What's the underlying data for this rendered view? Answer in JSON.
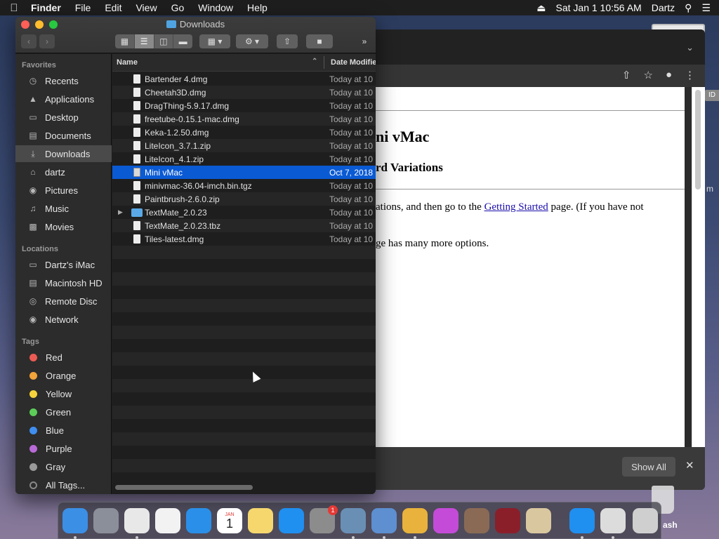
{
  "menubar": {
    "app_name": "Finder",
    "items": [
      "File",
      "Edit",
      "View",
      "Go",
      "Window",
      "Help"
    ],
    "clock": "Sat Jan 1  10:56 AM",
    "user": "Dartz"
  },
  "browser": {
    "heading1": "ni vMac",
    "heading2": "rd Variations",
    "para1_before": "ations, and then go to the ",
    "para1_link": "Getting Started",
    "para1_after": " page. (If you have not",
    "para2": "ge has many more options.",
    "show_all_label": "Show All",
    "edge_tab1": "ID",
    "edge_tab2": "m",
    "trash_label": "ash"
  },
  "finder": {
    "title": "Downloads",
    "sidebar": {
      "favorites_label": "Favorites",
      "favorites": [
        {
          "label": "Recents",
          "icon": "clock-icon"
        },
        {
          "label": "Applications",
          "icon": "applications-icon"
        },
        {
          "label": "Desktop",
          "icon": "desktop-icon"
        },
        {
          "label": "Documents",
          "icon": "documents-icon"
        },
        {
          "label": "Downloads",
          "icon": "downloads-icon",
          "selected": true
        },
        {
          "label": "dartz",
          "icon": "home-icon"
        },
        {
          "label": "Pictures",
          "icon": "camera-icon"
        },
        {
          "label": "Music",
          "icon": "music-note-icon"
        },
        {
          "label": "Movies",
          "icon": "film-icon"
        }
      ],
      "locations_label": "Locations",
      "locations": [
        {
          "label": "Dartz's iMac",
          "icon": "imac-icon"
        },
        {
          "label": "Macintosh HD",
          "icon": "hard-disk-icon"
        },
        {
          "label": "Remote Disc",
          "icon": "disc-icon"
        },
        {
          "label": "Network",
          "icon": "network-globe-icon"
        }
      ],
      "tags_label": "Tags",
      "tags": [
        {
          "label": "Red",
          "color": "#ec5b53"
        },
        {
          "label": "Orange",
          "color": "#f2a33a"
        },
        {
          "label": "Yellow",
          "color": "#f6d33c"
        },
        {
          "label": "Green",
          "color": "#5ccd58"
        },
        {
          "label": "Blue",
          "color": "#3f8ef0"
        },
        {
          "label": "Purple",
          "color": "#b86ad6"
        },
        {
          "label": "Gray",
          "color": "#9a9a9a"
        },
        {
          "label": "All Tags...",
          "color": "#555555"
        }
      ]
    },
    "columns": {
      "name": "Name",
      "date": "Date Modifie"
    },
    "files": [
      {
        "name": "Bartender 4.dmg",
        "date": "Today at 10",
        "kind": "file"
      },
      {
        "name": "Cheetah3D.dmg",
        "date": "Today at 10",
        "kind": "file"
      },
      {
        "name": "DragThing-5.9.17.dmg",
        "date": "Today at 10",
        "kind": "file"
      },
      {
        "name": "freetube-0.15.1-mac.dmg",
        "date": "Today at 10",
        "kind": "file"
      },
      {
        "name": "Keka-1.2.50.dmg",
        "date": "Today at 10",
        "kind": "file"
      },
      {
        "name": "LiteIcon_3.7.1.zip",
        "date": "Today at 10",
        "kind": "file"
      },
      {
        "name": "LiteIcon_4.1.zip",
        "date": "Today at 10",
        "kind": "file"
      },
      {
        "name": "Mini vMac",
        "date": "Oct 7, 2018",
        "kind": "app",
        "selected": true
      },
      {
        "name": "minivmac-36.04-imch.bin.tgz",
        "date": "Today at 10",
        "kind": "file"
      },
      {
        "name": "Paintbrush-2.6.0.zip",
        "date": "Today at 10",
        "kind": "file"
      },
      {
        "name": "TextMate_2.0.23",
        "date": "Today at 10",
        "kind": "folder"
      },
      {
        "name": "TextMate_2.0.23.tbz",
        "date": "Today at 10",
        "kind": "file"
      },
      {
        "name": "Tiles-latest.dmg",
        "date": "Today at 10",
        "kind": "file"
      }
    ]
  },
  "dock": {
    "apps": [
      {
        "name": "finder-icon",
        "color": "#3b8fe5"
      },
      {
        "name": "launchpad-icon",
        "color": "#8a8f99"
      },
      {
        "name": "chrome-icon",
        "color": "#e8e8e8"
      },
      {
        "name": "fantastical-icon",
        "color": "#f2f2f2"
      },
      {
        "name": "safari-icon",
        "color": "#2a8fe8"
      },
      {
        "name": "calendar-icon",
        "color": "#ffffff"
      },
      {
        "name": "notes-icon",
        "color": "#f5d76e"
      },
      {
        "name": "app-store-icon",
        "color": "#1f8ff0"
      },
      {
        "name": "system-preferences-icon",
        "color": "#8c8c8c"
      },
      {
        "name": "disk-utility-icon",
        "color": "#6a8fb5"
      },
      {
        "name": "keka-icon",
        "color": "#5d8fd1"
      },
      {
        "name": "cheetah3d-icon",
        "color": "#e8b23c"
      },
      {
        "name": "flower-icon",
        "color": "#c44bd8"
      },
      {
        "name": "bartender-icon",
        "color": "#8a6a55"
      },
      {
        "name": "wine-icon",
        "color": "#8a1f2a"
      },
      {
        "name": "paintbrush-icon",
        "color": "#d9c7a0"
      },
      {
        "name": "app-store-2-icon",
        "color": "#1f8ff0"
      },
      {
        "name": "mini-vmac-icon",
        "color": "#dcdcdc"
      },
      {
        "name": "trash-icon",
        "color": "#cfcfcf"
      }
    ],
    "calendar_month": "JAN",
    "calendar_day": "1",
    "system_prefs_badge": "1"
  }
}
